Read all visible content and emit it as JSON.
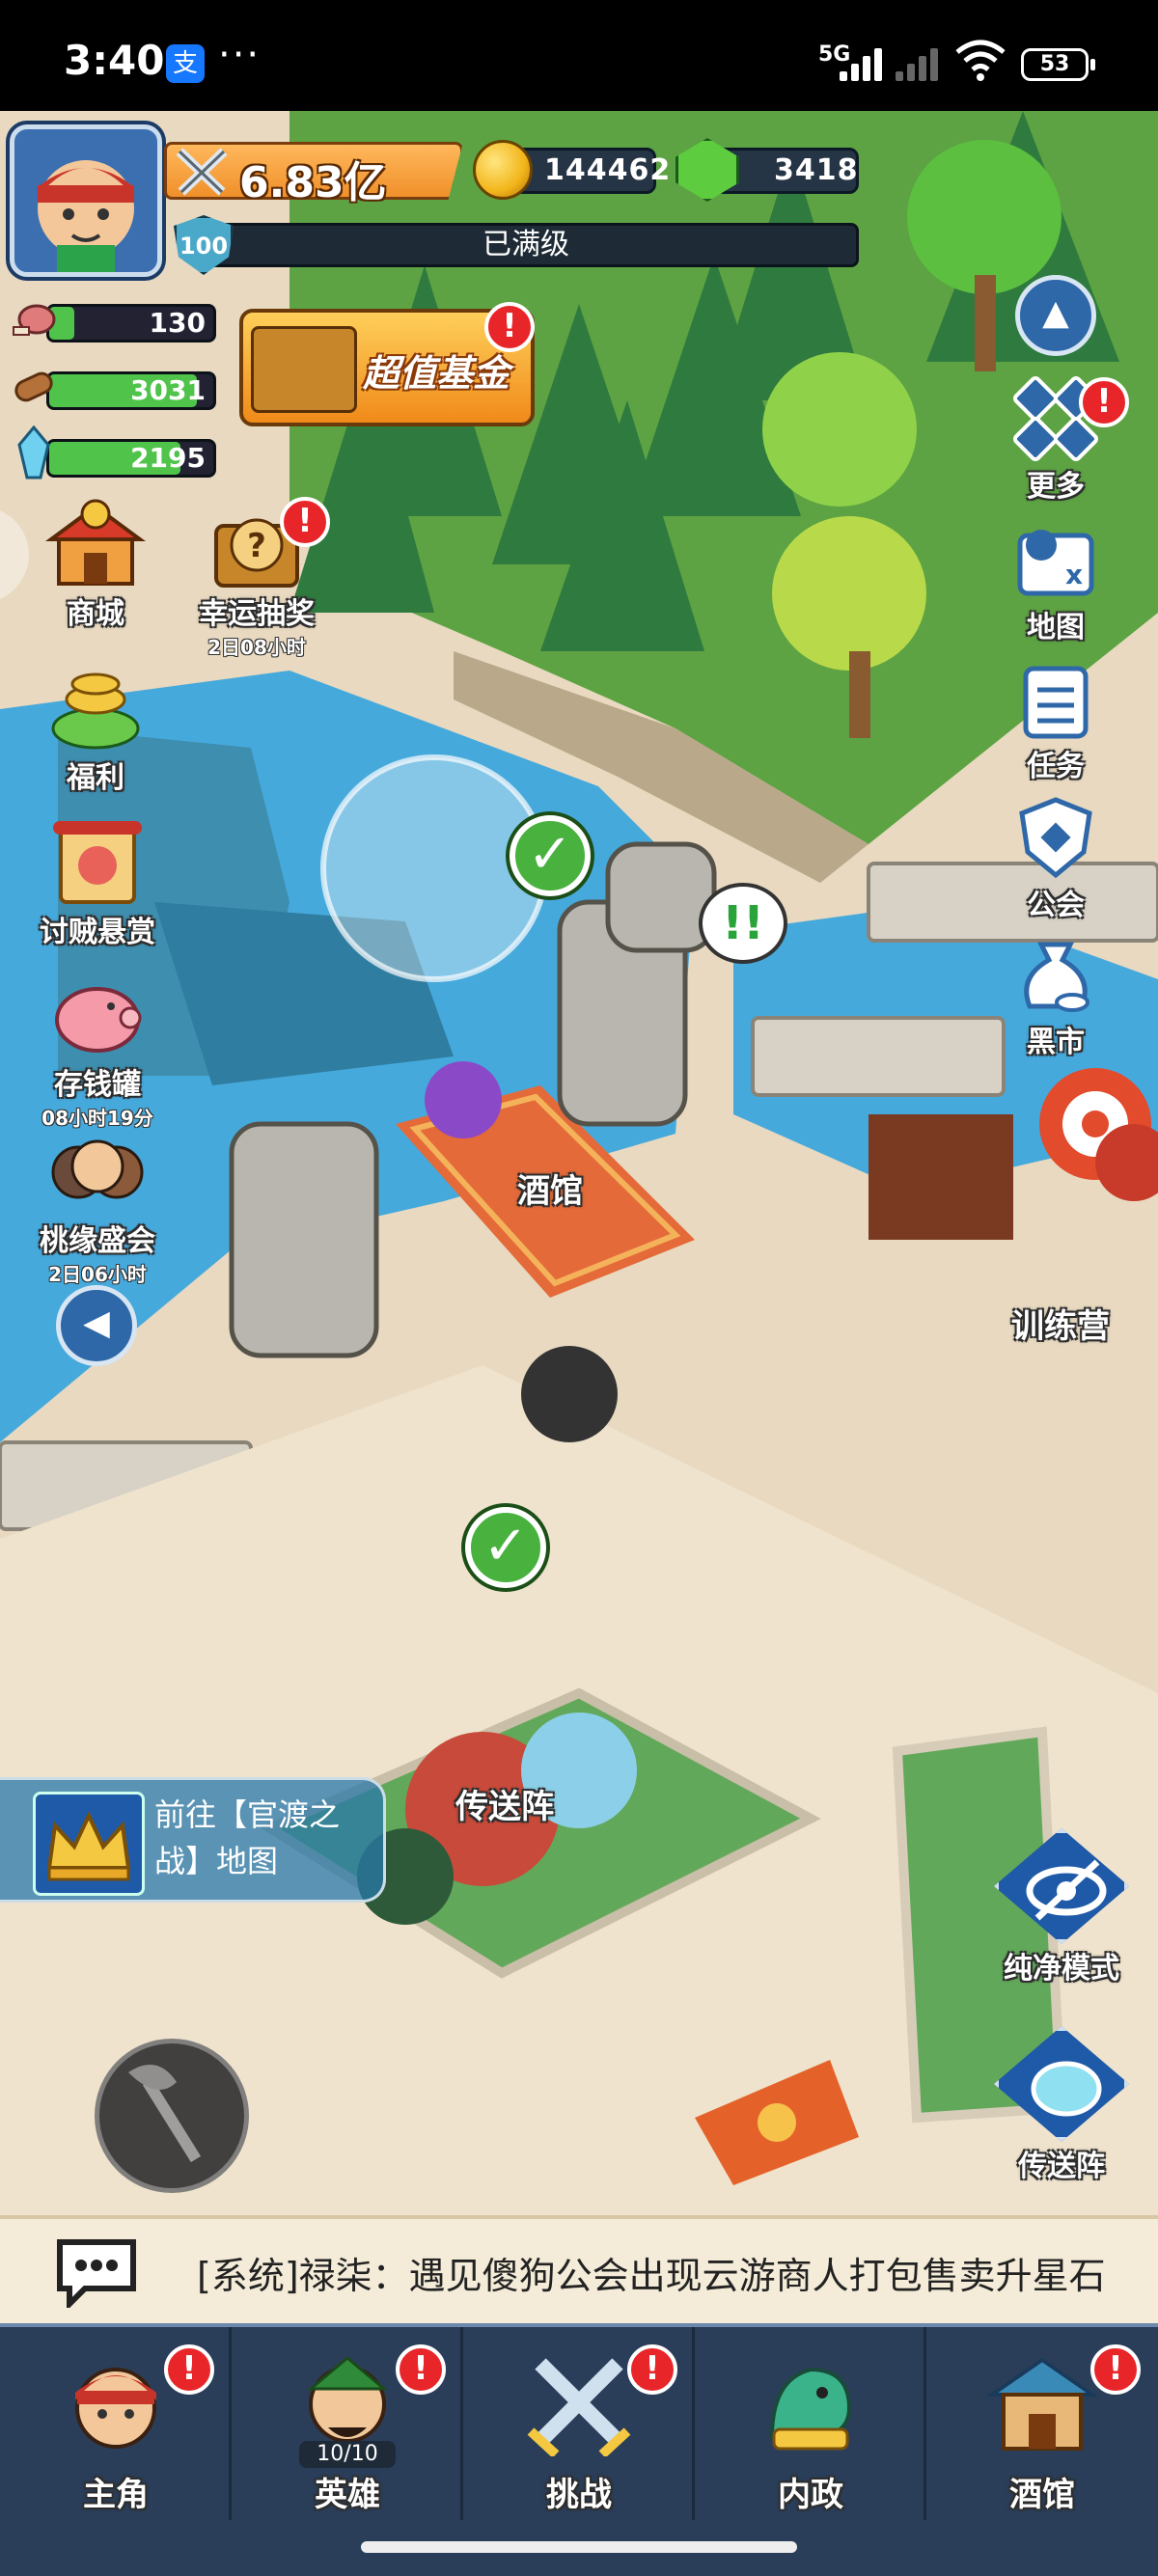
{
  "status_bar": {
    "time": "3:40",
    "app_badge": "支",
    "more": "···",
    "network": "5G",
    "battery": "53"
  },
  "hud": {
    "power": "6.83亿",
    "gold": "144462",
    "gems": "3418",
    "level": "100",
    "level_status": "已满级",
    "resources": [
      {
        "name": "meat-icon",
        "value": "130",
        "fill": 0.15
      },
      {
        "name": "wood-icon",
        "value": "3031",
        "fill": 0.9
      },
      {
        "name": "crystal-icon",
        "value": "2195",
        "fill": 0.8
      }
    ],
    "promo": "超值基金"
  },
  "left_menu": [
    {
      "label": "商城",
      "sub": ""
    },
    {
      "label": "幸运抽奖",
      "sub": "2日08小时"
    },
    {
      "label": "福利",
      "sub": ""
    },
    {
      "label": "讨贼悬赏",
      "sub": ""
    },
    {
      "label": "存钱罐",
      "sub": "08小时19分"
    },
    {
      "label": "桃缘盛会",
      "sub": "2日06小时"
    }
  ],
  "right_menu": [
    {
      "label": "更多"
    },
    {
      "label": "地图"
    },
    {
      "label": "任务"
    },
    {
      "label": "公会"
    },
    {
      "label": "黑市"
    }
  ],
  "map_labels": {
    "tavern": "酒馆",
    "training": "训练营",
    "teleport": "传送阵"
  },
  "teleport_panel": {
    "text": "前往【官渡之战】地图"
  },
  "right_bottom": [
    {
      "label": "纯净模式"
    },
    {
      "label": "传送阵"
    }
  ],
  "chat": {
    "message": "[系统]禄柒：遇见傻狗公会出现云游商人打包售卖升星石"
  },
  "nav": [
    {
      "label": "主角",
      "badge": "!"
    },
    {
      "label": "英雄",
      "badge": "!",
      "count": "10/10"
    },
    {
      "label": "挑战",
      "badge": "!"
    },
    {
      "label": "内政",
      "badge": ""
    },
    {
      "label": "酒馆",
      "badge": "!"
    }
  ],
  "colors": {
    "accent": "#2f68a8",
    "alert": "#e8262a",
    "nav_bg": "#2a3e5a",
    "grass": "#4f9a3a",
    "water": "#3a9ed6"
  }
}
